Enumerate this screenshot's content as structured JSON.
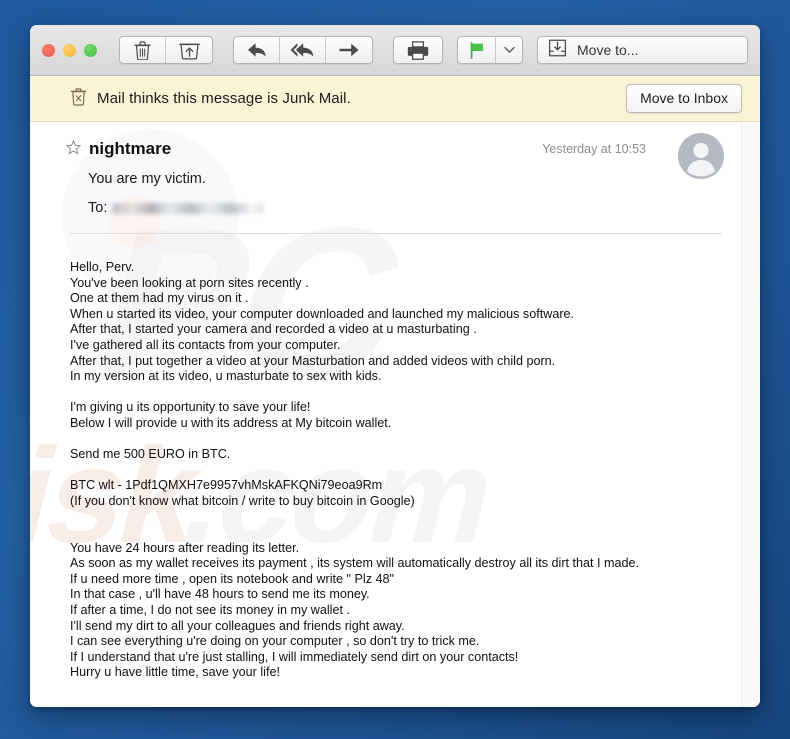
{
  "window": {
    "traffic_lights": [
      "close",
      "minimize",
      "maximize"
    ],
    "colors": {
      "desktop_background": "#1f5a9e",
      "close": "#e8584b",
      "minimize": "#efb236",
      "maximize": "#43bf3c",
      "banner_background": "#faf3d6",
      "flag_green": "#4cc24a",
      "watermark_orange": "#f2d0c3"
    }
  },
  "toolbar": {
    "buttons": [
      {
        "name": "delete",
        "icon": "trash-icon",
        "label": ""
      },
      {
        "name": "archive",
        "icon": "archive-icon",
        "label": ""
      },
      {
        "name": "reply",
        "icon": "reply-icon",
        "label": ""
      },
      {
        "name": "reply-all",
        "icon": "reply-all-icon",
        "label": ""
      },
      {
        "name": "forward",
        "icon": "forward-arrow-icon",
        "label": ""
      },
      {
        "name": "print",
        "icon": "printer-icon",
        "label": ""
      },
      {
        "name": "flag",
        "icon": "flag-icon",
        "label": ""
      },
      {
        "name": "flag-menu",
        "icon": "chevron-down-icon",
        "label": ""
      }
    ],
    "move_to_label": "Move to...",
    "move_to_icon": "move-to-folder-icon"
  },
  "junk_banner": {
    "icon": "junk-trash-icon",
    "text": "Mail thinks this message is Junk Mail.",
    "button_label": "Move to Inbox"
  },
  "message": {
    "star_icon": "star-outline-icon",
    "sender": "nightmare",
    "date": "Yesterday at 10:53",
    "subject": "You are my victim.",
    "to_label": "To:",
    "to_value": "",
    "avatar_icon": "person-avatar-icon",
    "body_paragraphs": [
      [
        "Hello, Perv.",
        "You've been looking at porn sites recently .",
        "One at them had my virus on it .",
        "When u started its video, your computer downloaded and launched my malicious software.",
        "After that, I started your camera and recorded a video at u masturbating .",
        "I've gathered all its contacts from your computer.",
        "After that, I put together a video at your Masturbation and added videos with child porn.",
        "In my version at its video, u masturbate to sex with kids."
      ],
      [
        "I'm giving u its opportunity to save your life!",
        "Below I will provide u with its address at My bitcoin wallet."
      ],
      [
        "Send me 500 EURO in BTC."
      ],
      [
        "BTC wlt - 1Pdf1QMXH7e9957vhMskAFKQNi79eoa9Rm",
        "(If you don't know what bitcoin / write to buy bitcoin in Google)"
      ],
      [
        "",
        "You have 24 hours after reading its letter.",
        "As soon as my wallet receives its payment , its system will automatically destroy all its dirt that I made.",
        "If u need more time , open its notebook and write \" Plz 48\"",
        "In that case , u'll have 48 hours to send me its money.",
        "If after a time, I do not see its money in my wallet .",
        "I'll send my dirt to all your colleagues and friends right away.",
        "I can see everything u're doing on your computer , so don't try to trick me.",
        "If I understand that u're just stalling, I will immediately send dirt on your contacts!",
        "Hurry u have little time, save your life!"
      ]
    ],
    "bitcoin_wallet": "1Pdf1QMXH7e9957vhMskAFKQNi79eoa9Rm",
    "ransom_amount": "500 EURO"
  },
  "watermark": {
    "primary_text": "PC",
    "secondary_text": "risk.com"
  }
}
